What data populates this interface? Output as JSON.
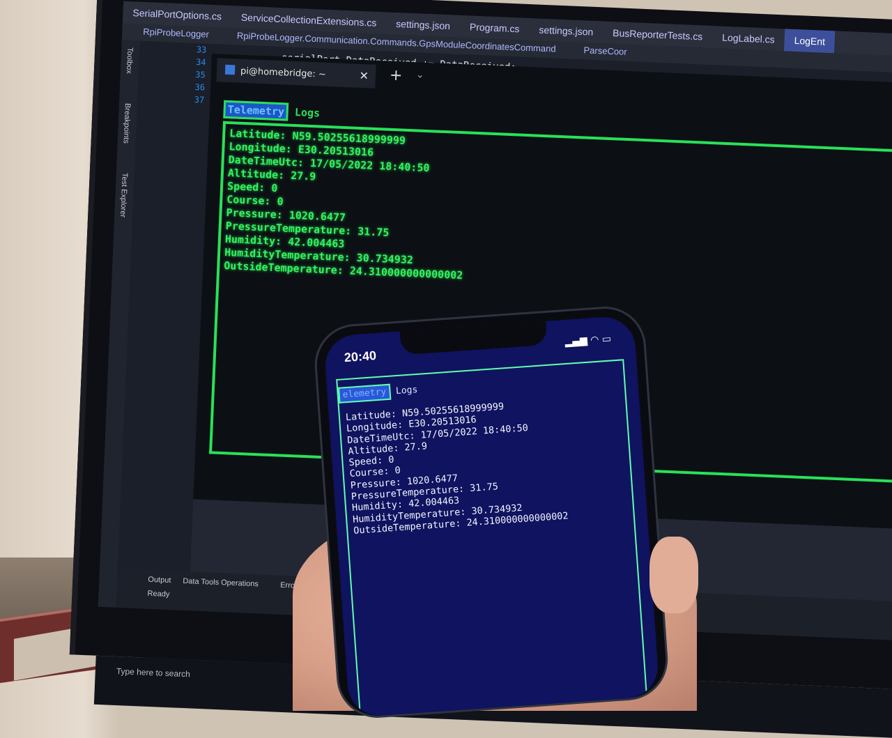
{
  "ide": {
    "tabs": [
      "SerialPortOptions.cs",
      "ServiceCollectionExtensions.cs",
      "settings.json",
      "Program.cs",
      "settings.json",
      "BusReporterTests.cs",
      "LogLabel.cs",
      "LogEnt"
    ],
    "nav": [
      "RpiProbeLogger",
      "RpiProbeLogger.Communication.Commands.GpsModuleCoordinatesCommand",
      "ParseCoor"
    ],
    "side_labels": [
      "Toolbox",
      "Breakpoints",
      "Test Explorer"
    ],
    "line_numbers": [
      "33",
      "34",
      "35",
      "36",
      "37"
    ],
    "code_line": "serialPort.DataReceived += DataReceived;",
    "status_items": [
      "Output",
      "Data Tools Operations",
      "Error L",
      "Ready"
    ],
    "search_placeholder": "Type here to search"
  },
  "terminal": {
    "tab_title": "pi@homebridge: ~",
    "close_glyph": "✕",
    "plus_glyph": "+",
    "chevron_glyph": "⌄",
    "tabs": {
      "active": "Telemetry",
      "other": "Logs"
    },
    "lines": [
      "Latitude: N59.50255618999999",
      "Longitude: E30.20513016",
      "DateTimeUtc: 17/05/2022 18:40:50",
      "Altitude: 27.9",
      "Speed: 0",
      "Course: 0",
      "Pressure: 1020.6477",
      "PressureTemperature: 31.75",
      "Humidity: 42.004463",
      "HumidityTemperature: 30.734932",
      "OutsideTemperature: 24.310000000000002"
    ]
  },
  "phone": {
    "time": "20:40",
    "status_icons": "▂▄▆ ◠ ▭",
    "tabs": {
      "active": "elemetry",
      "other": "Logs"
    },
    "lines": [
      "Latitude: N59.50255618999999",
      "Longitude: E30.20513016",
      "DateTimeUtc: 17/05/2022 18:40:50",
      "Altitude: 27.9",
      "Speed: 0",
      "Course: 0",
      "Pressure: 1020.6477",
      "PressureTemperature: 31.75",
      "Humidity: 42.004463",
      "HumidityTemperature: 30.734932",
      "OutsideTemperature: 24.310000000000002"
    ]
  },
  "colors": {
    "terminal_green": "#35f05f",
    "phone_background": "#10135f",
    "phone_border": "#5fffb0"
  }
}
